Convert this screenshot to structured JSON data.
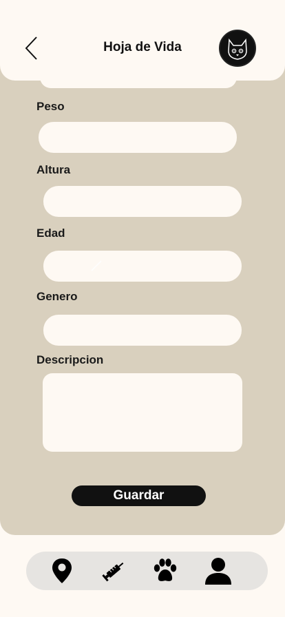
{
  "header": {
    "title": "Hoja de Vida",
    "back_icon": "chevron-left-icon",
    "avatar_icon": "cat-face-icon"
  },
  "form": {
    "peso_label": "Peso",
    "altura_label": "Altura",
    "edad_label": "Edad",
    "genero_label": "Genero",
    "descripcion_label": "Descripcion",
    "peso_value": "",
    "altura_value": "",
    "edad_value": "",
    "genero_value": "",
    "descripcion_value": ""
  },
  "actions": {
    "save_label": "Guardar"
  },
  "bottom_nav": {
    "items": [
      {
        "icon": "map-pin-icon"
      },
      {
        "icon": "syringe-icon"
      },
      {
        "icon": "paw-icon"
      },
      {
        "icon": "user-icon"
      }
    ]
  },
  "colors": {
    "background": "#fef9f3",
    "panel": "#d9d0be",
    "nav": "#e6e4e1",
    "button": "#111111"
  }
}
